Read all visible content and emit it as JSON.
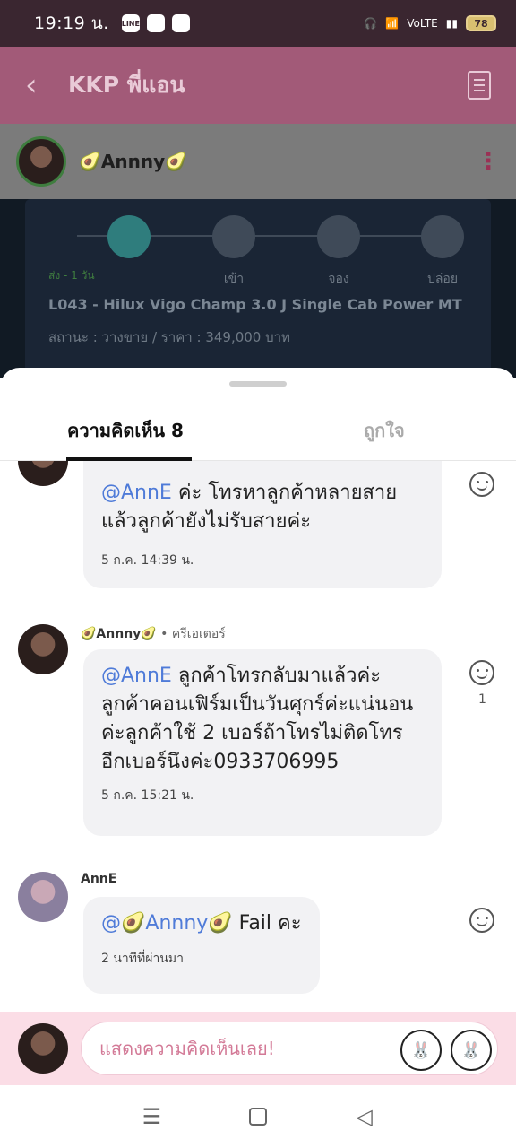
{
  "status_bar": {
    "time": "19:19 น.",
    "app_icons": [
      "LINE",
      "",
      ""
    ],
    "network_label": "VoLTE",
    "battery": "78"
  },
  "header": {
    "title": "KKP พี่แอน"
  },
  "post_author": {
    "name": "🥑Annny🥑"
  },
  "card": {
    "steps": [
      "",
      "เข้า",
      "จอง",
      "ปล่อย"
    ],
    "meta": "ส่ง - 1 วัน",
    "car": "L043 - Hilux Vigo Champ 3.0 J Single Cab Power MT",
    "status": "สถานะ : วางขาย / ราคา : 349,000 บาท"
  },
  "tabs": {
    "comments": "ความคิดเห็น 8",
    "likes": "ถูกใจ"
  },
  "comments": [
    {
      "mention": "@AnnE",
      "text": " ค่ะ โทรหาลูกค้าหลายสาย แล้วลูกค้ายังไม่รับสายค่ะ",
      "time": "5 ก.ค. 14:39 น."
    },
    {
      "author": "🥑Annny🥑",
      "role": " • ครีเอเตอร์",
      "mention": "@AnnE",
      "text": " ลูกค้าโทรกลับมาแล้วค่ะ ลูกค้าคอนเฟิร์มเป็นวันศุกร์ค่ะแน่นอน ค่ะลูกค้าใช้ 2 เบอร์ถ้าโทรไม่ติดโทร อีกเบอร์นึงค่ะ0933706995",
      "time": "5 ก.ค. 15:21 น.",
      "likes": "1"
    },
    {
      "author": "AnnE",
      "mention": "@🥑Annny🥑",
      "text": " Fail คะ",
      "time": "2 นาทีที่ผ่านมา"
    }
  ],
  "input": {
    "placeholder": "แสดงความคิดเห็นเลย!"
  },
  "colors": {
    "accent": "#a25a78",
    "mention": "#4f7bd8",
    "input_bg": "#fbdde6"
  }
}
